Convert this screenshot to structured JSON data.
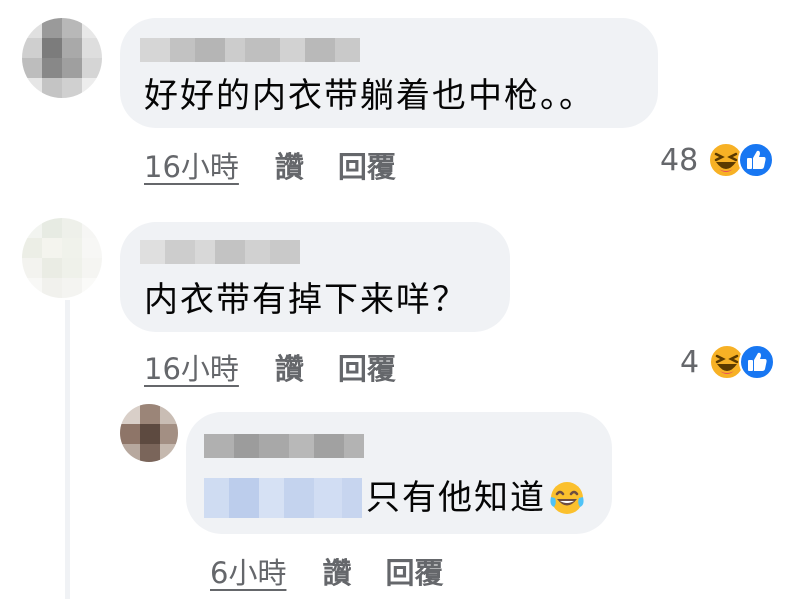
{
  "comments": [
    {
      "text": "好好的内衣带躺着也中枪。。",
      "time": "16小時",
      "like_label": "讚",
      "reply_label": "回覆",
      "reaction_count": "48"
    },
    {
      "text": "内衣带有掉下来咩？",
      "time": "16小時",
      "like_label": "讚",
      "reply_label": "回覆",
      "reaction_count": "4"
    },
    {
      "text": "只有他知道",
      "time": "6小時",
      "like_label": "讚",
      "reply_label": "回覆"
    }
  ],
  "colors": {
    "bubble": "#f0f2f5",
    "meta_text": "#65676b",
    "like_blue": "#1877f2",
    "haha_yellow": "#f7b125"
  },
  "icons": [
    "haha-reaction-icon",
    "like-reaction-icon",
    "tears-of-joy-emoji-icon"
  ]
}
